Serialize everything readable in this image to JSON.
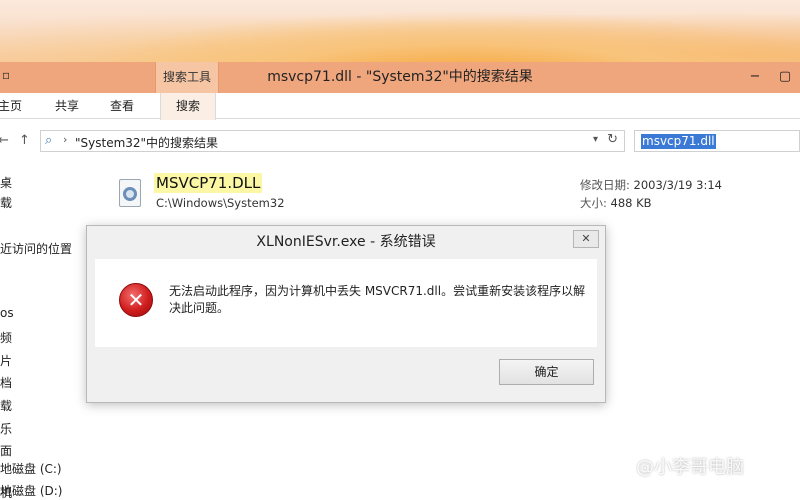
{
  "window": {
    "title": "msvcp71.dll - \"System32\"中的搜索结果",
    "tool_tab": "搜索工具",
    "minimize": "−",
    "maximize": "▢",
    "close": "✕"
  },
  "ribbon": {
    "tabs": [
      "主页",
      "共享",
      "查看",
      "搜索"
    ]
  },
  "address": {
    "back": "←",
    "forward": "→",
    "up": "↑",
    "location": "\"System32\"中的搜索结果",
    "search_value": "msvcp71.dll"
  },
  "nav_pane": {
    "items": [
      "桌",
      "载",
      "近访问的位置",
      "",
      "os",
      "",
      "频",
      "片",
      "档",
      "载",
      "乐",
      "面",
      "",
      "机",
      "地磁盘 (C:)",
      "地磁盘 (D:)"
    ]
  },
  "result": {
    "name": "MSVCP71.DLL",
    "path": "C:\\Windows\\System32",
    "modified_label": "修改日期:",
    "modified_value": "2003/3/19 3:14",
    "size_label": "大小:",
    "size_value": "488 KB"
  },
  "dialog": {
    "title": "XLNonIESvr.exe - 系统错误",
    "close": "✕",
    "icon": "error-icon",
    "message": "无法启动此程序，因为计算机中丢失 MSVCR71.dll。尝试重新安装该程序以解决此问题。",
    "ok_label": "确定"
  },
  "watermark": "@小李哥电脑"
}
